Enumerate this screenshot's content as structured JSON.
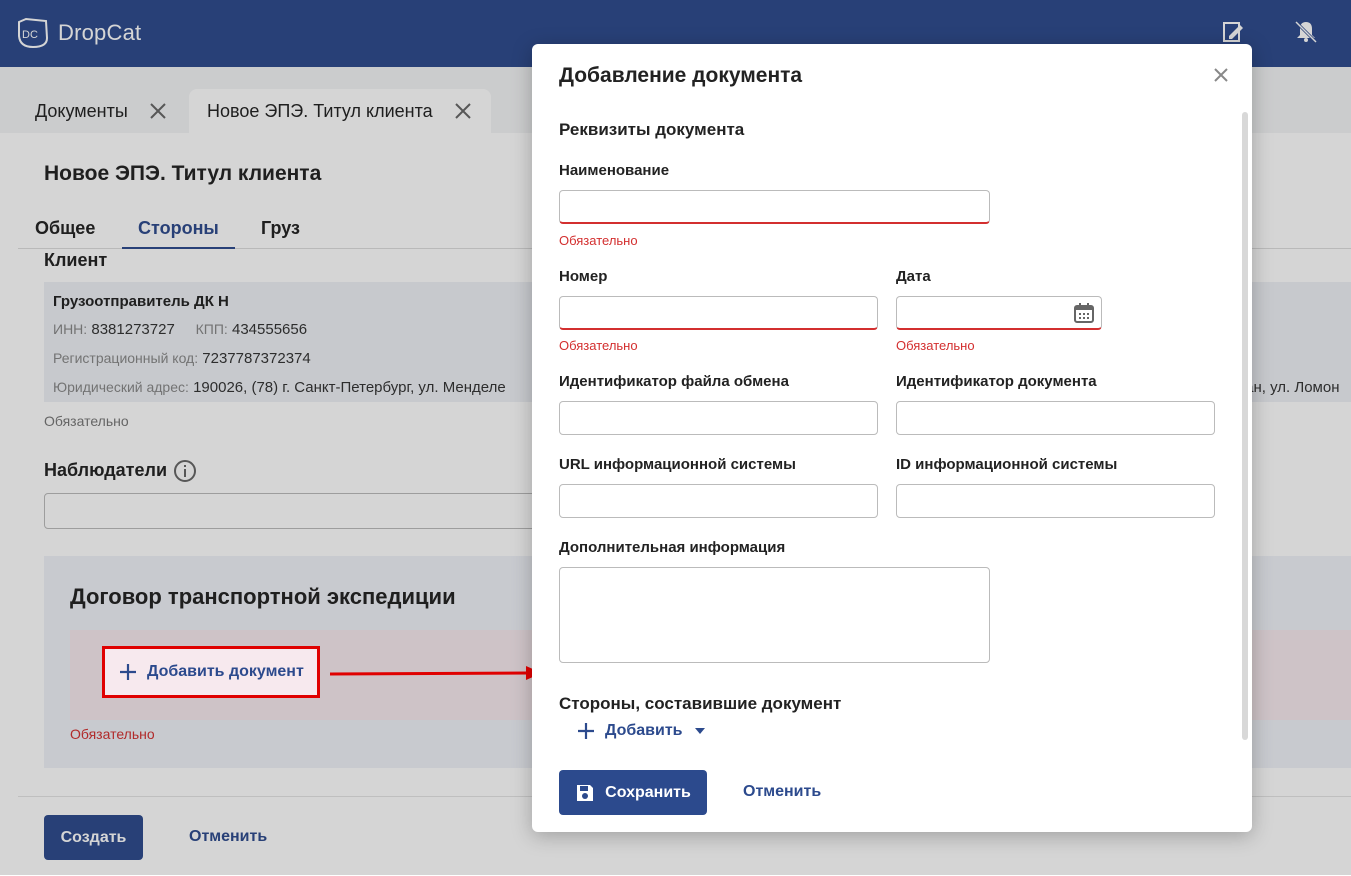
{
  "app": {
    "name": "DropCat"
  },
  "tabs": [
    {
      "label": "Документы"
    },
    {
      "label": "Новое ЭПЭ. Титул клиента"
    }
  ],
  "page": {
    "title": "Новое ЭПЭ. Титул клиента",
    "sub_tabs": [
      "Общее",
      "Стороны",
      "Груз"
    ],
    "client": {
      "section_label": "Клиент",
      "name": "Грузоотправитель ДК Н",
      "inn_label": "ИНН:",
      "inn": "8381273727",
      "kpp_label": "КПП:",
      "kpp": "434555656",
      "reg_label": "Регистрационный код:",
      "reg_code": "7237787372374",
      "address_label": "Юридический адрес:",
      "address": "190026, (78) г. Санкт-Петербург, ул. Менделе",
      "address_tail": "ган, ул. Ломон",
      "required": "Обязательно"
    },
    "observers_label": "Наблюдатели",
    "contract": {
      "title": "Договор транспортной экспедиции",
      "add_document": "Добавить документ",
      "required": "Обязательно"
    },
    "footer": {
      "create": "Создать",
      "cancel": "Отменить"
    }
  },
  "modal": {
    "title": "Добавление документа",
    "section": "Реквизиты документа",
    "fields": {
      "name": {
        "label": "Наименование",
        "error": "Обязательно"
      },
      "number": {
        "label": "Номер",
        "error": "Обязательно"
      },
      "date": {
        "label": "Дата",
        "error": "Обязательно"
      },
      "exchange_file_id": {
        "label": "Идентификатор файла обмена"
      },
      "document_id": {
        "label": "Идентификатор документа"
      },
      "is_url": {
        "label": "URL информационной системы"
      },
      "is_id": {
        "label": "ID информационной системы"
      },
      "extra_info": {
        "label": "Дополнительная информация"
      }
    },
    "parties_section": "Стороны, составившие документ",
    "add_parties": "Добавить",
    "save": "Сохранить",
    "cancel": "Отменить"
  },
  "colors": {
    "primary": "#2c4a8d",
    "error": "#d32f2f",
    "highlight": "#e00000"
  }
}
